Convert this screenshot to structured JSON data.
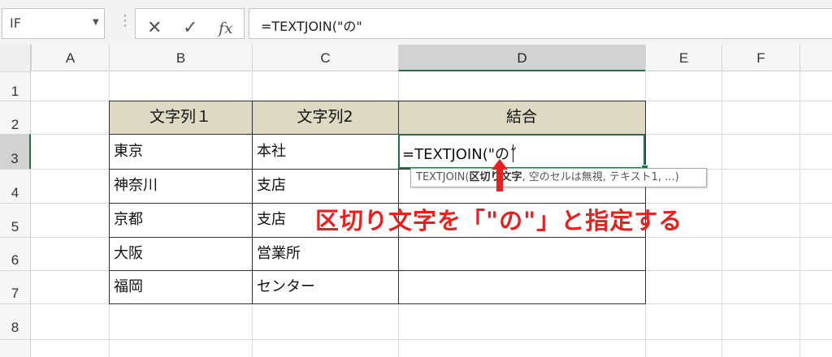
{
  "formula_bar": {
    "name_box": "IF",
    "cancel_icon": "✕",
    "enter_icon": "✓",
    "function_icon": "fx",
    "formula": "=TEXTJOIN(\"の\""
  },
  "columns": [
    "A",
    "B",
    "C",
    "D",
    "E",
    "F"
  ],
  "rows": [
    "1",
    "2",
    "3",
    "4",
    "5",
    "6",
    "7",
    "8"
  ],
  "table": {
    "headers": [
      "文字列１",
      "文字列2",
      "結合"
    ],
    "rows": [
      [
        "東京",
        "本社"
      ],
      [
        "神奈川",
        "支店"
      ],
      [
        "京都",
        "支店"
      ],
      [
        "大阪",
        "営業所"
      ],
      [
        "福岡",
        "センター"
      ]
    ]
  },
  "active_cell": {
    "address": "D3",
    "content": "=TEXTJOIN(\"の˝"
  },
  "tooltip": {
    "func": "TEXTJOIN(",
    "arg_bold": "区切り文字",
    "rest": ", 空のセルは無視, テキスト1, ...)"
  },
  "annotation": "区切り文字を「\"の\"」と指定する",
  "colors": {
    "accent": "#217346",
    "header_fill": "#ddd9c3",
    "annotation": "#e8211f"
  }
}
